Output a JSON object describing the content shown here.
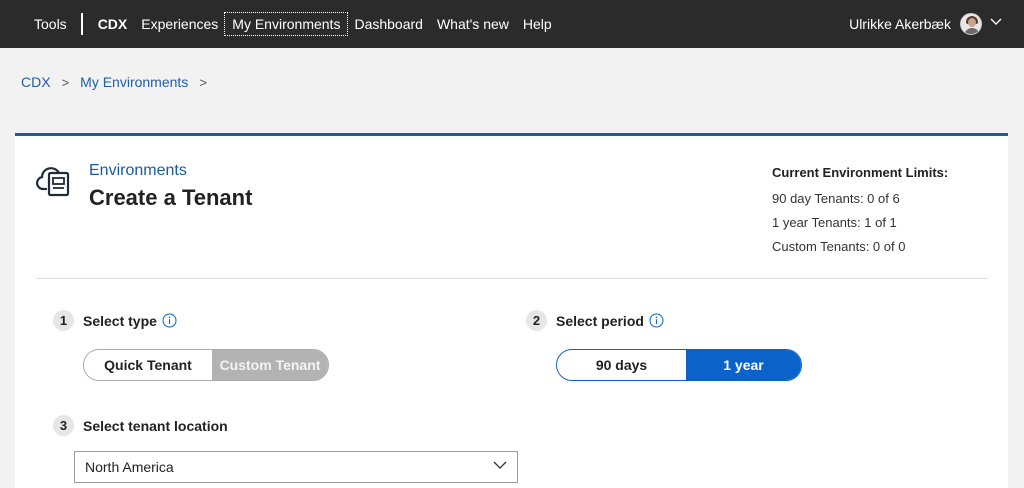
{
  "nav": {
    "tools": "Tools",
    "brand": "CDX",
    "items": [
      "Experiences",
      "My Environments",
      "Dashboard",
      "What's new",
      "Help"
    ],
    "active_index": 1,
    "user_name": "Ulrikke Akerbæk"
  },
  "breadcrumb": {
    "items": [
      "CDX",
      "My Environments"
    ],
    "separator": ">"
  },
  "header": {
    "section": "Environments",
    "title": "Create a Tenant"
  },
  "limits": {
    "title": "Current Environment Limits:",
    "lines": [
      "90 day Tenants: 0 of 6",
      "1 year Tenants: 1 of 1",
      "Custom Tenants: 0 of 0"
    ]
  },
  "steps": {
    "type": {
      "number": "1",
      "label": "Select type",
      "options": [
        "Quick Tenant",
        "Custom Tenant"
      ],
      "selected": "Quick Tenant"
    },
    "period": {
      "number": "2",
      "label": "Select period",
      "options": [
        "90 days",
        "1 year"
      ],
      "selected": "1 year"
    },
    "location": {
      "number": "3",
      "label": "Select tenant location",
      "value": "North America"
    }
  },
  "icons": {
    "environment": "cloud-document-icon",
    "info": "info-icon",
    "dropdown": "chevron-down-icon"
  },
  "colors": {
    "nav_bg": "#2b2b2b",
    "accent": "#1a5b9e",
    "toggle_selected": "#0b63c9",
    "toggle_inactive": "#b3b3b3"
  }
}
